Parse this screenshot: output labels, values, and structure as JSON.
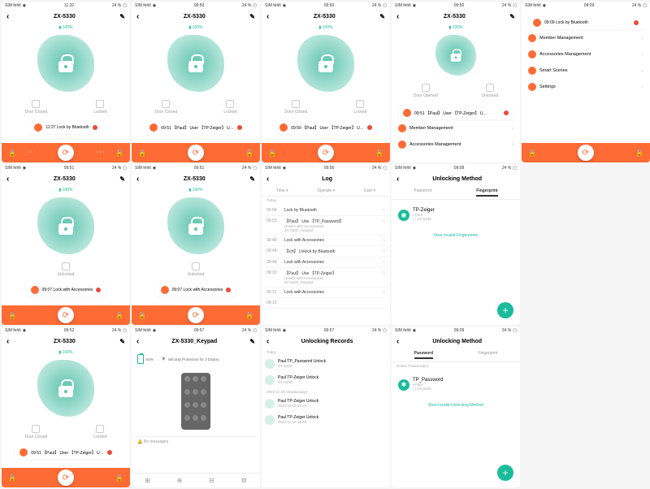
{
  "status": {
    "carrier": "SIM fehlt",
    "wifi": "◉",
    "batt_pct": "24 %",
    "batt_icon": "▢"
  },
  "times": [
    "11:32",
    "09:50",
    "09:50",
    "09:50",
    "09:09",
    "09:51",
    "09:51",
    "09:52",
    "09:56",
    "09:08",
    "09:52",
    "09:57",
    "09:57",
    "09:09"
  ],
  "device": "ZX-5330",
  "device_keypad": "ZX-5330_Keypad",
  "battery": "100%",
  "door_closed": "Door Closed",
  "door_opened": "Door Opened",
  "locked": "Locked",
  "unlocked": "Unlocked",
  "alerts": {
    "s1": "11:27  Lock by Bluetooth",
    "s2": "09:51  【Paul】 User 【TP-Zeiger】 U…",
    "s3": "09:50  【Paul】 User 【TP-Zeiger】 U…",
    "s4": "09:51  【Paul】 User 【TP-Zeiger】 U…",
    "s5": "09:09  Lock by Bluetooth",
    "s6": "09:07  Lock with Accessories",
    "s7": "09:07  Lock with Accessories",
    "s11": "09:51  【Paul】 User 【TP-Zeiger】 U…"
  },
  "menu": {
    "member": "Member Management",
    "accessories": "Accessories Management",
    "scenes": "Smart Scenes",
    "settings": "Settings"
  },
  "log": {
    "title": "Log",
    "tabs": [
      "Time ▾",
      "Operate ▾",
      "User ▾"
    ],
    "today": "Today",
    "items": [
      {
        "t": "09:56",
        "x": "Lock by Bluetooth"
      },
      {
        "t": "09:53",
        "x": "【Paul】 Use 【TP_Password】",
        "s": "Unlock with Accessories",
        "d": "ZX-5330_Keypad"
      },
      {
        "t": "09:49",
        "x": "Lock with Accessories"
      },
      {
        "t": "09:49",
        "x": "【Ich】  Unlock by Bluetooth"
      },
      {
        "t": "09:49",
        "x": "Lock with Accessories"
      },
      {
        "t": "09:10",
        "x": "【Paul】 Use 【TP-Zeiger】",
        "s": "Unlock with Accessories",
        "d": "ZX-5330_Keypad"
      },
      {
        "t": "09:12",
        "x": "Lock with Accessories"
      },
      {
        "t": "09:12",
        "x": ""
      }
    ]
  },
  "unlock_method": {
    "title": "Unlocking Method",
    "tabs": [
      "Password",
      "Fingerprint"
    ],
    "fp_name": "TP-Zeiger",
    "fp_user": "Paul",
    "fp_device": "ZX-5330",
    "view_fp": "View Invalid Fingerprints",
    "pw_section": "Online Password(1)",
    "pw_name": "TP_Password",
    "view_pw": "View Invalid Unlocking Method"
  },
  "keypad": {
    "bat": "84%",
    "security": "Security Protection for 2 Day(s)",
    "no_msg": "No messages"
  },
  "records": {
    "title": "Unlocking Records",
    "today": "Today",
    "items": [
      {
        "n": "Paul TP_Password Unlock",
        "d": "ZX-5330"
      },
      {
        "n": "Paul TP-Zeiger Unlock",
        "d": "ZX-5330"
      }
    ],
    "date": "2022-11-18 (Wednesday)",
    "old": [
      {
        "n": "Paul TP-Zeiger Unlock",
        "d": "2022-11-18 18:25"
      },
      {
        "n": "Paul TP-Zeiger Unlock",
        "d": "2022-11-18 18:25"
      }
    ]
  }
}
